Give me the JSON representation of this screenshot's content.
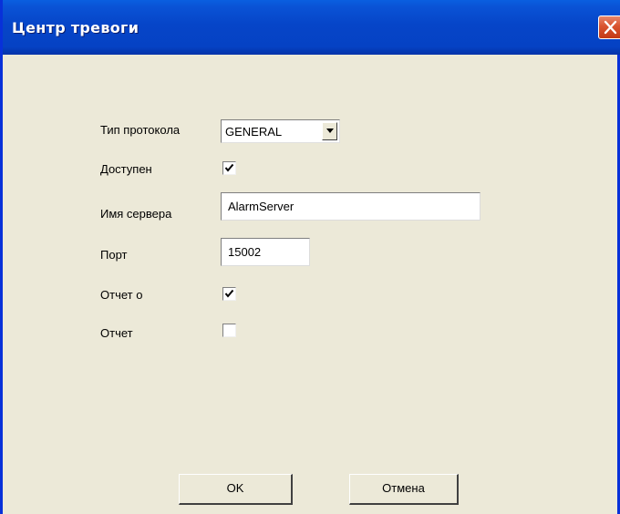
{
  "window": {
    "title": "Центр тревоги",
    "close_icon": "close-x-icon",
    "title_bar_color": "#0a53d6"
  },
  "form": {
    "protocol_type": {
      "label": "Тип протокола",
      "value": "GENERAL",
      "dropdown_icon": "chevron-down-icon"
    },
    "enabled": {
      "label": "Доступен",
      "checked": true
    },
    "server_name": {
      "label": "Имя сервера",
      "value": "AlarmServer"
    },
    "port": {
      "label": "Порт",
      "value": "15002"
    },
    "report_on": {
      "label": "Отчет о",
      "checked": true
    },
    "report": {
      "label": "Отчет",
      "checked": false
    }
  },
  "buttons": {
    "ok_label": "OK",
    "cancel_label": "Отмена"
  }
}
